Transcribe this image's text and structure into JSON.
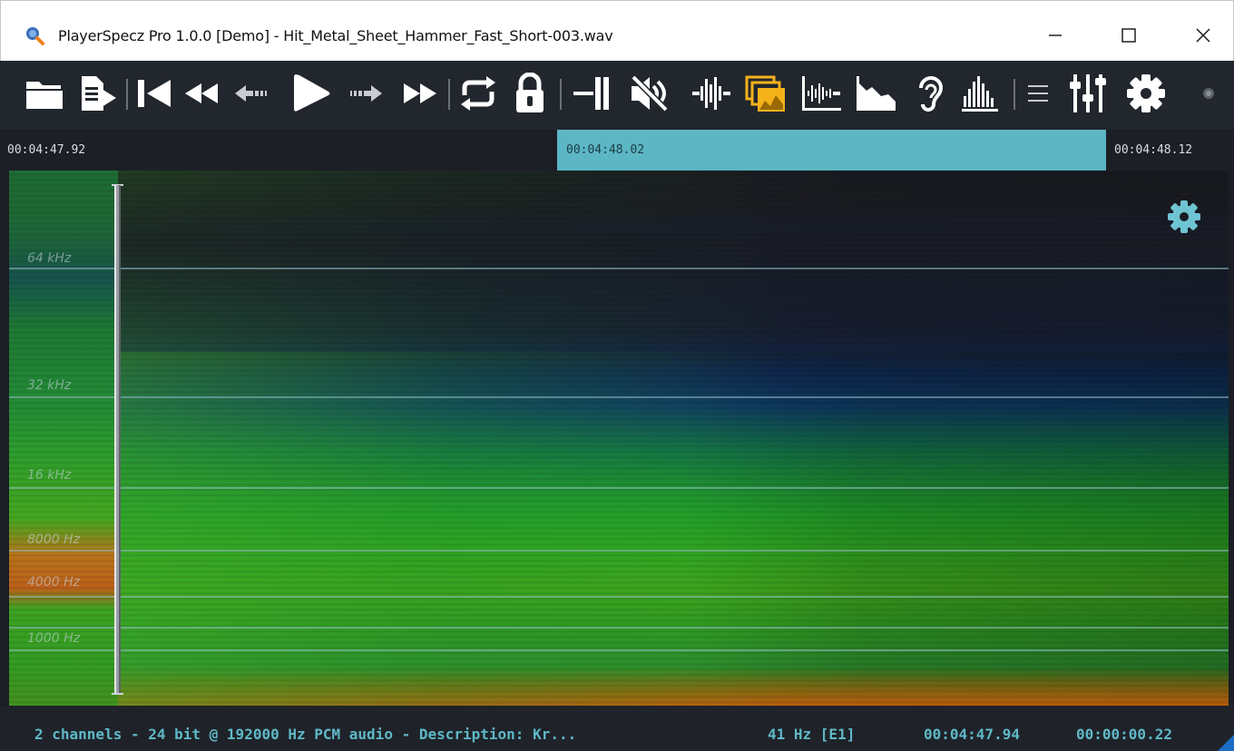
{
  "window": {
    "title": "PlayerSpecz Pro 1.0.0 [Demo] - Hit_Metal_Sheet_Hammer_Fast_Short-003.wav",
    "app_icon": "magnifier-app-icon",
    "controls": [
      "minimize-icon",
      "maximize-icon",
      "close-icon"
    ]
  },
  "toolbar": {
    "buttons": [
      {
        "name": "open-folder-icon"
      },
      {
        "name": "playlist-export-icon"
      },
      {
        "name": "skip-to-start-icon"
      },
      {
        "name": "rewind-icon"
      },
      {
        "name": "step-back-icon"
      },
      {
        "name": "play-icon"
      },
      {
        "name": "step-forward-icon"
      },
      {
        "name": "fast-forward-icon"
      },
      {
        "name": "repeat-icon"
      },
      {
        "name": "lock-icon"
      },
      {
        "name": "marker-icon"
      },
      {
        "name": "mute-icon"
      },
      {
        "name": "waveform-icon"
      },
      {
        "name": "spectrogram-layers-icon",
        "active": true
      },
      {
        "name": "waveform-view-icon"
      },
      {
        "name": "spectrum-view-icon"
      },
      {
        "name": "ear-icon"
      },
      {
        "name": "histogram-icon"
      },
      {
        "name": "menu-icon"
      },
      {
        "name": "mixer-icon"
      },
      {
        "name": "settings-gear-icon"
      },
      {
        "name": "status-dot-icon"
      }
    ],
    "accent_color": "#f4b21a",
    "icon_color": "#ffffff"
  },
  "timeline": {
    "start": "00:04:47.92",
    "selection_start": "00:04:48.02",
    "end": "00:04:48.12",
    "selection_color": "#5cb6c4"
  },
  "spectrogram": {
    "frequency_labels": [
      "64 kHz",
      "32 kHz",
      "16 kHz",
      "8000 Hz",
      "4000 Hz",
      "1000 Hz"
    ],
    "settings_icon": "gear-icon"
  },
  "status": {
    "description": "2 channels - 24 bit @ 192000 Hz PCM audio - Description: Kr...",
    "frequency": "41 Hz [E1]",
    "position": "00:04:47.94",
    "duration": "00:00:00.22",
    "text_color": "#5fb8c7"
  }
}
